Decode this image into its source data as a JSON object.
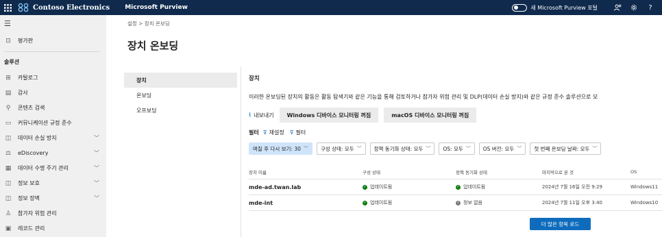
{
  "topbar": {
    "org_name": "Contoso Electronics",
    "app_name": "Microsoft Purview",
    "toggle_label": "새 Microsoft Purview 포털",
    "icons": [
      "waffle-icon",
      "contoso-logo",
      "people-icon",
      "gear-icon",
      "help-icon"
    ],
    "help_glyph": "?",
    "background": "#0f2a4d"
  },
  "leftnav": {
    "section_label": "솔루션",
    "top_items": [
      {
        "label": "평가판",
        "icon": "trial-icon"
      }
    ],
    "items": [
      {
        "label": "카탈로그",
        "icon": "catalog-icon",
        "chevron": false
      },
      {
        "label": "감사",
        "icon": "audit-icon",
        "chevron": false
      },
      {
        "label": "콘텐츠 검색",
        "icon": "search-icon",
        "chevron": false
      },
      {
        "label": "커뮤니케이션 규정 준수",
        "icon": "communication-icon",
        "chevron": false
      },
      {
        "label": "데이터 손실 방지",
        "icon": "dlp-icon",
        "chevron": true
      },
      {
        "label": "eDiscovery",
        "icon": "ediscovery-icon",
        "chevron": true
      },
      {
        "label": "데이터 수명 주기 관리",
        "icon": "lifecycle-icon",
        "chevron": true
      },
      {
        "label": "정보 보호",
        "icon": "info-protection-icon",
        "chevron": true
      },
      {
        "label": "정보 장벽",
        "icon": "info-barrier-icon",
        "chevron": true
      },
      {
        "label": "참가자 위험 관리",
        "icon": "insider-risk-icon",
        "chevron": false
      },
      {
        "label": "레코드 관리",
        "icon": "records-icon",
        "chevron": false
      }
    ]
  },
  "breadcrumb": "설정  >  장치 온보딩",
  "page_title": "장치 온보딩",
  "subnav": [
    {
      "label": "장치",
      "active": true
    },
    {
      "label": "온보딩",
      "active": false
    },
    {
      "label": "오프보딩",
      "active": false
    }
  ],
  "section_title": "장치",
  "description": "이러한 온보딩된 장치의 활동은 활동 탐색기와 같은 기능을 통해 검토하거나 참가자 위험 관리 및 DLP(데이터 손실 방지)와 같은 규정 준수 솔루션으로 모",
  "actions": {
    "export_label": "내보내기",
    "windows_monitoring": "Windows 디바이스 모니터링 꺼짐",
    "macos_monitoring": "macOS 디바이스 모니터링 꺼짐"
  },
  "filters": {
    "label": "필터",
    "reset": "재설정",
    "filter": "필터",
    "chips": [
      {
        "label": "며칠 후 다시 보기: 30",
        "active": true
      },
      {
        "label": "구성 상태:  모두",
        "active": false
      },
      {
        "label": "정책 동기화 상태:  모두",
        "active": false
      },
      {
        "label": "OS:  모두",
        "active": false
      },
      {
        "label": "OS 버전:  모두",
        "active": false
      },
      {
        "label": "첫 번째 온보딩 날짜:  모두",
        "active": false
      }
    ]
  },
  "table": {
    "columns": [
      "장치 이름",
      "구성 상태",
      "정책 동기화 상태",
      "마지막으로 본 것",
      "OS"
    ],
    "rows": [
      {
        "name": "mde-ad.twan.lab",
        "config": "업데이트됨",
        "config_status": "green",
        "sync": "업데이트됨",
        "sync_status": "green",
        "last_seen": "2024년 7월 16일 오전 9:29",
        "os": "Windows11"
      },
      {
        "name": "mde-int",
        "config": "업데이트됨",
        "config_status": "green",
        "sync": "정보 없음",
        "sync_status": "grey",
        "last_seen": "2024년 7월 11일 오후 3:40",
        "os": "Windows10"
      }
    ]
  },
  "load_more": "더 많은 항목 로드",
  "colors": {
    "accent": "#0f6cbd",
    "success": "#107c10",
    "chip_active": "#cfe4fa"
  }
}
